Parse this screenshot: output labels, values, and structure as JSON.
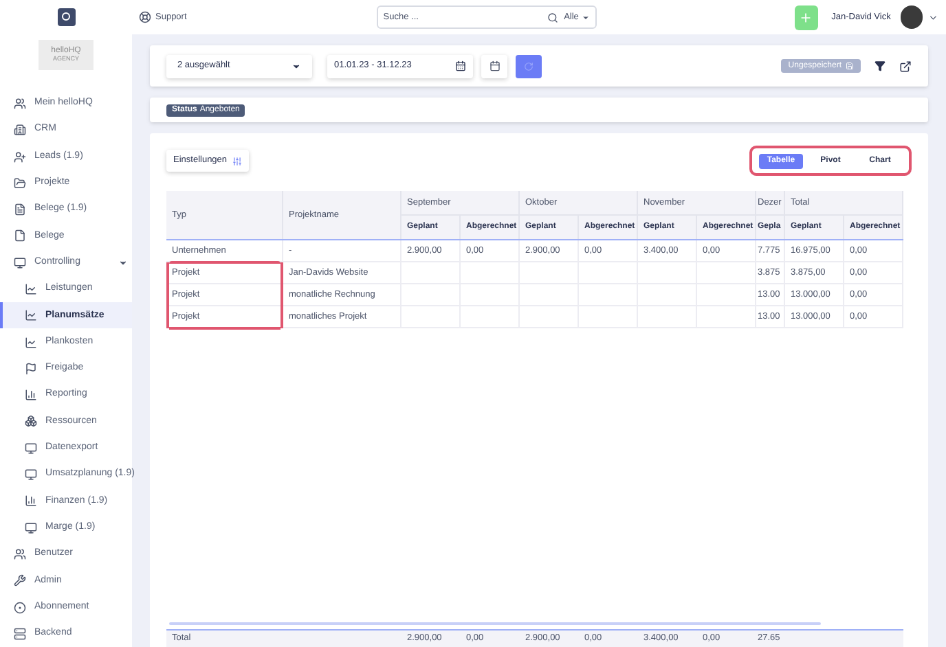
{
  "sidebar": {
    "logo_text": "helloHQ",
    "logo_subtext": "AGENCY",
    "items": [
      {
        "label": "Mein helloHQ",
        "selected": false
      },
      {
        "label": "CRM",
        "selected": false
      },
      {
        "label": "Leads (1.9)",
        "selected": false
      },
      {
        "label": "Projekte",
        "selected": false
      },
      {
        "label": "Belege (1.9)",
        "selected": false
      },
      {
        "label": "Belege",
        "selected": false
      },
      {
        "label": "Controlling",
        "selected": false,
        "expanded": true,
        "children": [
          {
            "label": "Leistungen",
            "selected": false
          },
          {
            "label": "Planumsätze",
            "selected": true
          },
          {
            "label": "Plankosten",
            "selected": false
          },
          {
            "label": "Freigabe",
            "selected": false
          },
          {
            "label": "Reporting",
            "selected": false
          },
          {
            "label": "Ressourcen",
            "selected": false
          },
          {
            "label": "Datenexport",
            "selected": false
          },
          {
            "label": "Umsatzplanung (1.9)",
            "selected": false
          },
          {
            "label": "Finanzen (1.9)",
            "selected": false
          },
          {
            "label": "Marge (1.9)",
            "selected": false
          }
        ]
      },
      {
        "label": "Benutzer",
        "selected": false
      },
      {
        "label": "Admin",
        "selected": false
      },
      {
        "label": "Abonnement",
        "selected": false
      },
      {
        "label": "Backend",
        "selected": false
      }
    ]
  },
  "topbar": {
    "support": "Support",
    "search": {
      "placeholder": "Suche ..."
    },
    "scope": "Alle",
    "user_name": "Jan-David Vick"
  },
  "toolbar": {
    "selection": "2 ausgewählt",
    "date_range": "01.01.23 - 31.12.23",
    "save_state": "Ungespeichert"
  },
  "filter_chip": {
    "key": "Status",
    "value": "Angeboten"
  },
  "settings_button": "Einstellungen",
  "view_tabs": [
    {
      "label": "Tabelle",
      "selected": true
    },
    {
      "label": "Pivot",
      "selected": false
    },
    {
      "label": "Chart",
      "selected": false
    }
  ],
  "table": {
    "fixed_columns": [
      "Typ",
      "Projektname"
    ],
    "groups": [
      {
        "label": "September",
        "columns": [
          "Geplant",
          "Abgerechnet"
        ]
      },
      {
        "label": "Oktober",
        "columns": [
          "Geplant",
          "Abgerechnet"
        ]
      },
      {
        "label": "November",
        "columns": [
          "Geplant",
          "Abgerechnet"
        ]
      },
      {
        "label": "Dezer",
        "columns": [
          "Gepla"
        ]
      },
      {
        "label": "Total",
        "columns": [
          "Geplant",
          "Abgerechnet"
        ]
      }
    ],
    "rows": [
      {
        "cells": [
          "Unternehmen",
          "-",
          "2.900,00",
          "0,00",
          "2.900,00",
          "0,00",
          "3.400,00",
          "0,00",
          "7.775",
          "16.975,00",
          "0,00"
        ],
        "highlighted": false
      },
      {
        "cells": [
          "Projekt",
          "Jan-Davids Website",
          "",
          "",
          "",
          "",
          "",
          "",
          "3.875",
          "3.875,00",
          "0,00"
        ],
        "highlighted": true
      },
      {
        "cells": [
          "Projekt",
          "monatliche Rechnung",
          "",
          "",
          "",
          "",
          "",
          "",
          "13.00",
          "13.000,00",
          "0,00"
        ],
        "highlighted": true
      },
      {
        "cells": [
          "Projekt",
          "monatliches Projekt",
          "",
          "",
          "",
          "",
          "",
          "",
          "13.00",
          "13.000,00",
          "0,00"
        ],
        "highlighted": true
      }
    ],
    "total_row": {
      "label": "Total",
      "values": [
        "2.900,00",
        "0,00",
        "2.900,00",
        "0,00",
        "3.400,00",
        "0,00",
        "27.65"
      ]
    }
  }
}
